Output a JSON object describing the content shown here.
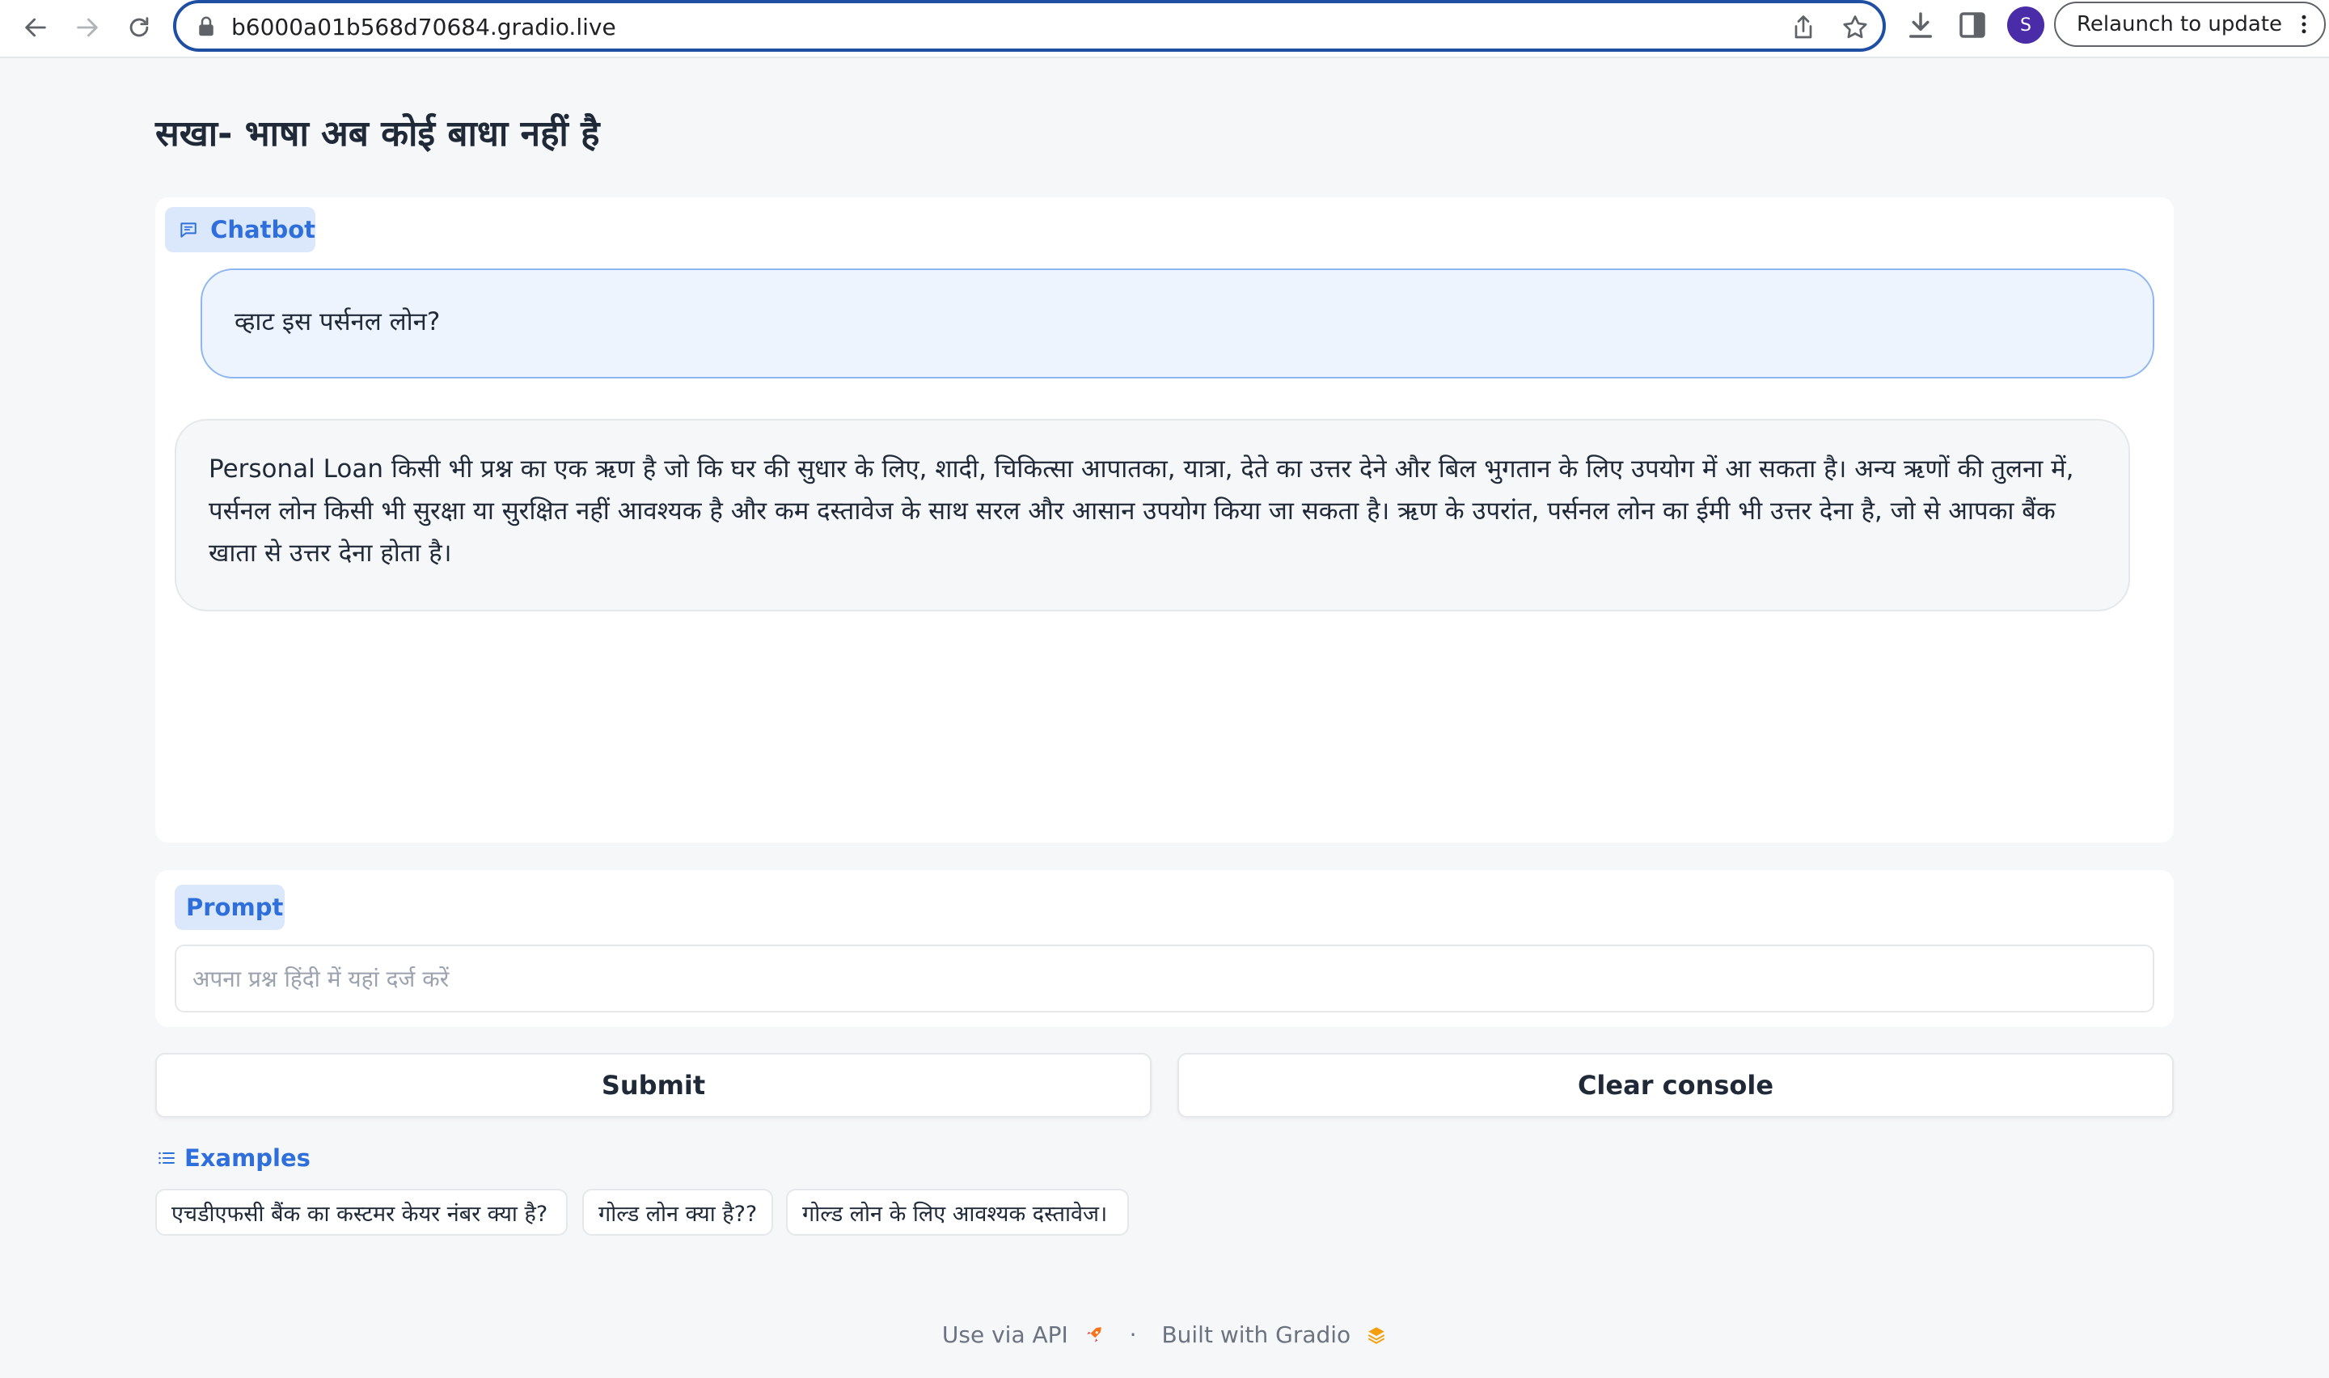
{
  "browser": {
    "url": "b6000a01b568d70684.gradio.live",
    "avatar_initial": "S",
    "relaunch_label": "Relaunch to update"
  },
  "page": {
    "title": "सखा- भाषा अब कोई बाधा नहीं है"
  },
  "chatbot": {
    "label": "Chatbot",
    "messages": [
      {
        "role": "user",
        "text": "व्हाट इस पर्सनल लोन?"
      },
      {
        "role": "bot",
        "text": "Personal Loan किसी भी प्रश्न का एक ऋण है जो कि घर की सुधार के लिए, शादी, चिकित्सा आपातका, यात्रा, देते का उत्तर देने और बिल भुगतान के लिए उपयोग में आ सकता है। अन्य ऋणों की तुलना में, पर्सनल लोन किसी भी सुरक्षा या सुरक्षित नहीं आवश्यक है और कम दस्तावेज के साथ सरल और आसान उपयोग किया जा सकता है। ऋण के उपरांत, पर्सनल लोन का ईमी भी उत्तर देना है, जो से आपका बैंक खाता से उत्तर देना होता है।"
      }
    ]
  },
  "prompt": {
    "label": "Prompt",
    "placeholder": "अपना प्रश्न हिंदी में यहां दर्ज करें",
    "value": ""
  },
  "actions": {
    "submit_label": "Submit",
    "clear_label": "Clear console"
  },
  "examples": {
    "label": "Examples",
    "items": [
      "एचडीएफसी बैंक का कस्टमर केयर नंबर क्या है?",
      "गोल्ड लोन क्या है??",
      "गोल्ड लोन के लिए आवश्यक दस्तावेज।"
    ]
  },
  "footer": {
    "api_label": "Use via API",
    "separator": "·",
    "built_label": "Built with Gradio"
  },
  "colors": {
    "accent": "#2f6fdc",
    "badge_bg": "#dbe8fb",
    "user_bubble": "#eef4fe",
    "user_border": "#8fb7ef",
    "address_border": "#1f4fa3",
    "avatar": "#4a2ca8"
  }
}
